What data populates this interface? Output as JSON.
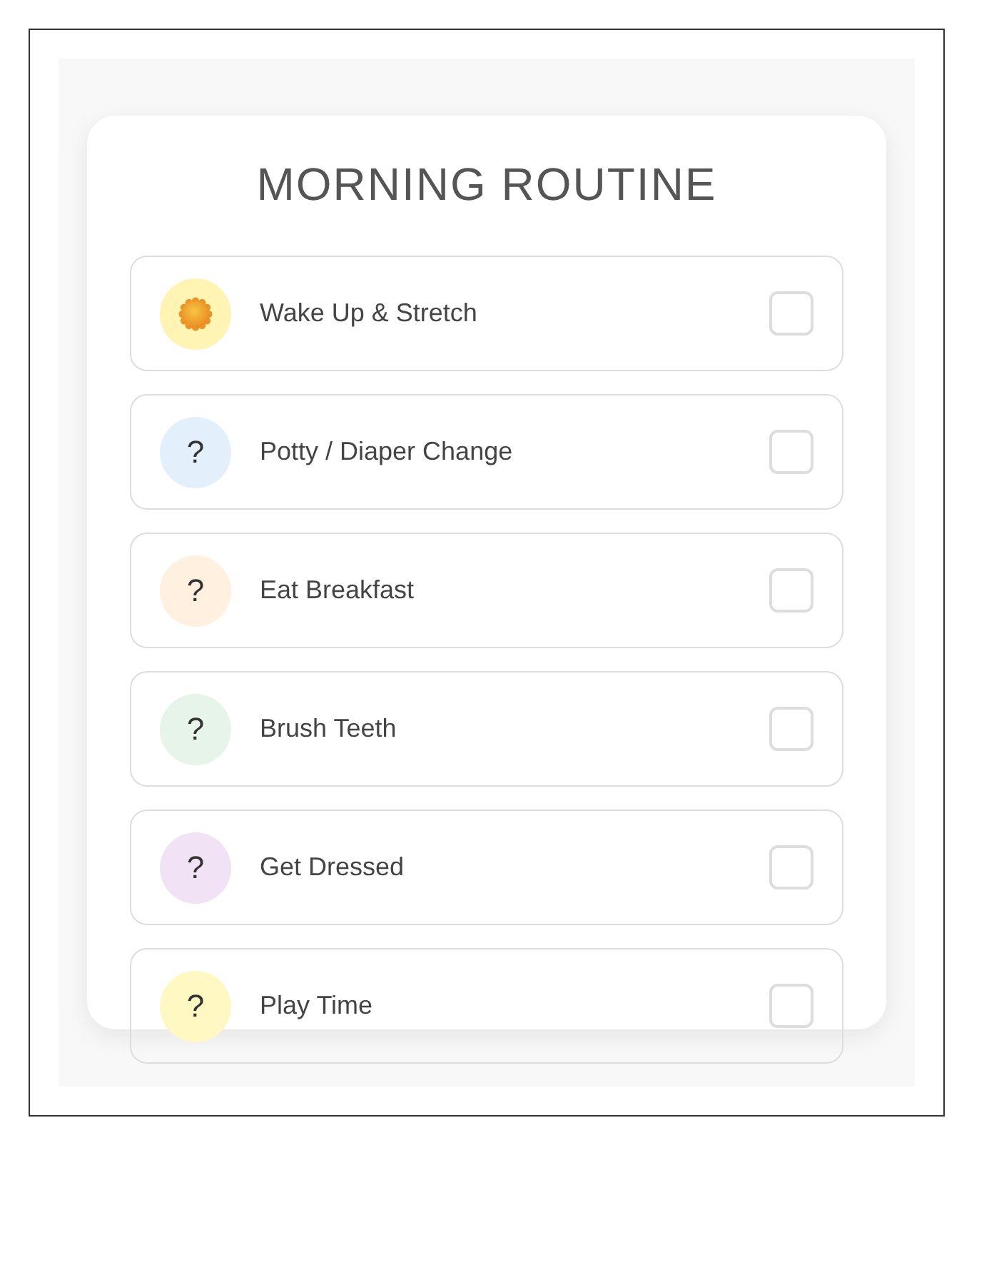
{
  "title": "MORNING ROUTINE",
  "items": [
    {
      "label": "Wake Up & Stretch",
      "checked": false,
      "color": "#fff4b3",
      "icon": {
        "kind": "sun"
      }
    },
    {
      "label": "Potty / Diaper Change",
      "checked": false,
      "color": "#e3f0fc",
      "icon": {
        "kind": "glyph",
        "text": "?"
      }
    },
    {
      "label": "Eat Breakfast",
      "checked": false,
      "color": "#fff0df",
      "icon": {
        "kind": "glyph",
        "text": "?"
      }
    },
    {
      "label": "Brush Teeth",
      "checked": false,
      "color": "#e6f4e9",
      "icon": {
        "kind": "glyph",
        "text": "?"
      }
    },
    {
      "label": "Get Dressed",
      "checked": false,
      "color": "#f1e3f5",
      "icon": {
        "kind": "glyph",
        "text": "?"
      }
    },
    {
      "label": "Play Time",
      "checked": false,
      "color": "#fff8c2",
      "icon": {
        "kind": "glyph",
        "text": "?"
      }
    }
  ]
}
